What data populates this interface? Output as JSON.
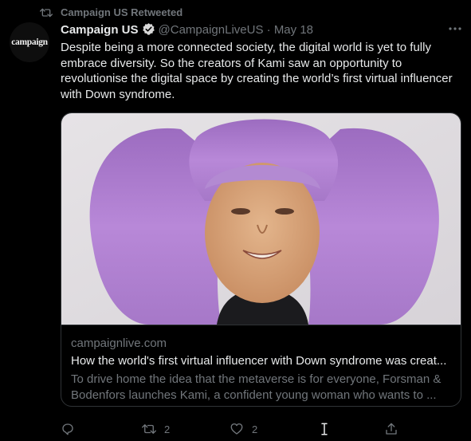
{
  "retweet": {
    "label": "Campaign US Retweeted"
  },
  "author": {
    "avatar_text": "campaign",
    "name": "Campaign US",
    "handle": "@CampaignLiveUS",
    "separator": "·",
    "date": "May 18"
  },
  "tweet": {
    "text": "Despite being a more connected society, the digital world is yet to fully embrace diversity. So the creators of Kami saw an opportunity to revolutionise the digital space by creating the world’s first virtual influencer with Down syndrome."
  },
  "card": {
    "domain": "campaignlive.com",
    "title": "How the world's first virtual influencer with Down syndrome was creat...",
    "description": "To drive home the idea that the metaverse is for everyone, Forsman & Bodenfors launches Kami, a confident young woman who wants to ..."
  },
  "actions": {
    "reply": {
      "icon": "reply-icon"
    },
    "retweet": {
      "icon": "retweet-icon",
      "count": "2"
    },
    "like": {
      "icon": "heart-icon",
      "count": "2"
    },
    "extra": {
      "icon": "text-cursor-icon"
    },
    "share": {
      "icon": "share-icon"
    }
  },
  "colors": {
    "background": "#000000",
    "text": "#e7e9ea",
    "secondary": "#71767b",
    "border": "#2f3336",
    "verified": "#d9d9d9",
    "hair": "#b07fd0"
  }
}
